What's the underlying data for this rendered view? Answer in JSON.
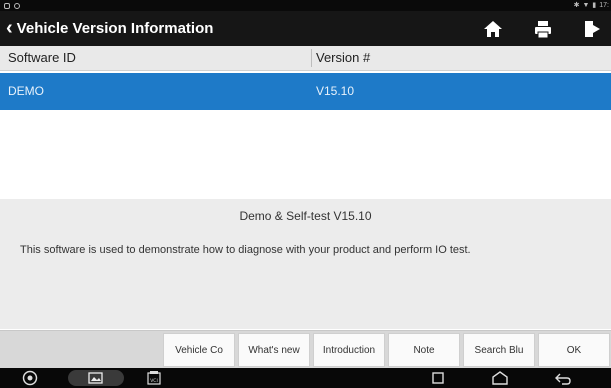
{
  "status": {
    "time": "17:"
  },
  "title": {
    "text": "Vehicle Version Information"
  },
  "table": {
    "headers": [
      "Software ID",
      "Version #"
    ],
    "rows": [
      {
        "software_id": "DEMO",
        "version": "V15.10"
      }
    ]
  },
  "description": {
    "title": "Demo & Self-test V15.10",
    "text": "This software is used to demonstrate how to diagnose with your product and perform IO test."
  },
  "buttons": {
    "vehicle_coverage": "Vehicle Co",
    "whats_new": "What's new",
    "introduction": "Introduction",
    "note": "Note",
    "search_bluetooth": "Search Blu",
    "ok": "OK"
  },
  "colors": {
    "accent": "#1e7ac8",
    "titlebar": "#161616"
  }
}
